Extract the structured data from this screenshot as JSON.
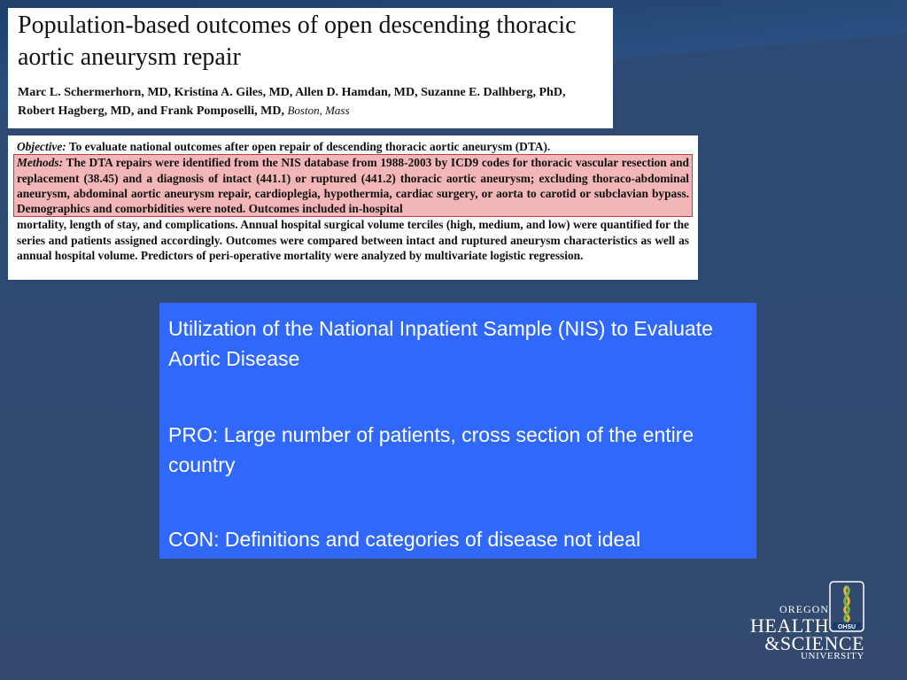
{
  "paper": {
    "title": "Population-based outcomes of open descending thoracic aortic aneurysm repair",
    "authors": "Marc L. Schermerhorn, MD, Kristina A. Giles, MD, Allen D. Hamdan, MD, Suzanne E. Dalhberg, PhD, Robert Hagberg, MD, and Frank Pomposelli, MD,",
    "location": "Boston, Mass"
  },
  "abstract": {
    "objective_label": "Objective:",
    "objective_text": "To evaluate national outcomes after open repair of descending thoracic aortic aneurysm (DTA).",
    "methods_label": "Methods:",
    "methods_highlighted": "The DTA repairs were identified from the NIS database from 1988-2003 by ICD9 codes for thoracic vascular resection and replacement (38.45) and a diagnosis of intact (441.1) or ruptured (441.2) thoracic aortic aneurysm; excluding thoraco-abdominal aneurysm, abdominal aortic aneurysm repair, cardioplegia, hypothermia, cardiac surgery, or aorta to carotid or subclavian bypass. Demographics and comorbidities were noted. Outcomes included in-hospital",
    "methods_rest": "mortality, length of stay, and complications. Annual hospital surgical volume terciles (high, medium, and low) were quantified for the series and patients assigned accordingly. Outcomes were compared between intact and ruptured aneurysm characteristics as well as annual hospital volume. Predictors of peri-operative mortality were analyzed by multivariate logistic regression."
  },
  "summary": {
    "heading": "Utilization of the National Inpatient Sample (NIS) to Evaluate Aortic Disease",
    "pro": "PRO:  Large number of patients, cross section of the entire country",
    "con": "CON: Definitions and categories of disease not ideal"
  },
  "logo": {
    "line1": "OREGON",
    "line2": "HEALTH",
    "line3": "&SCIENCE",
    "line4": "UNIVERSITY",
    "badge": "OHSU"
  },
  "colors": {
    "background": "#2f4a72",
    "summary_box": "#2f68fb",
    "highlight_fill": "#f2b6b8",
    "highlight_border": "#c23a3a"
  }
}
